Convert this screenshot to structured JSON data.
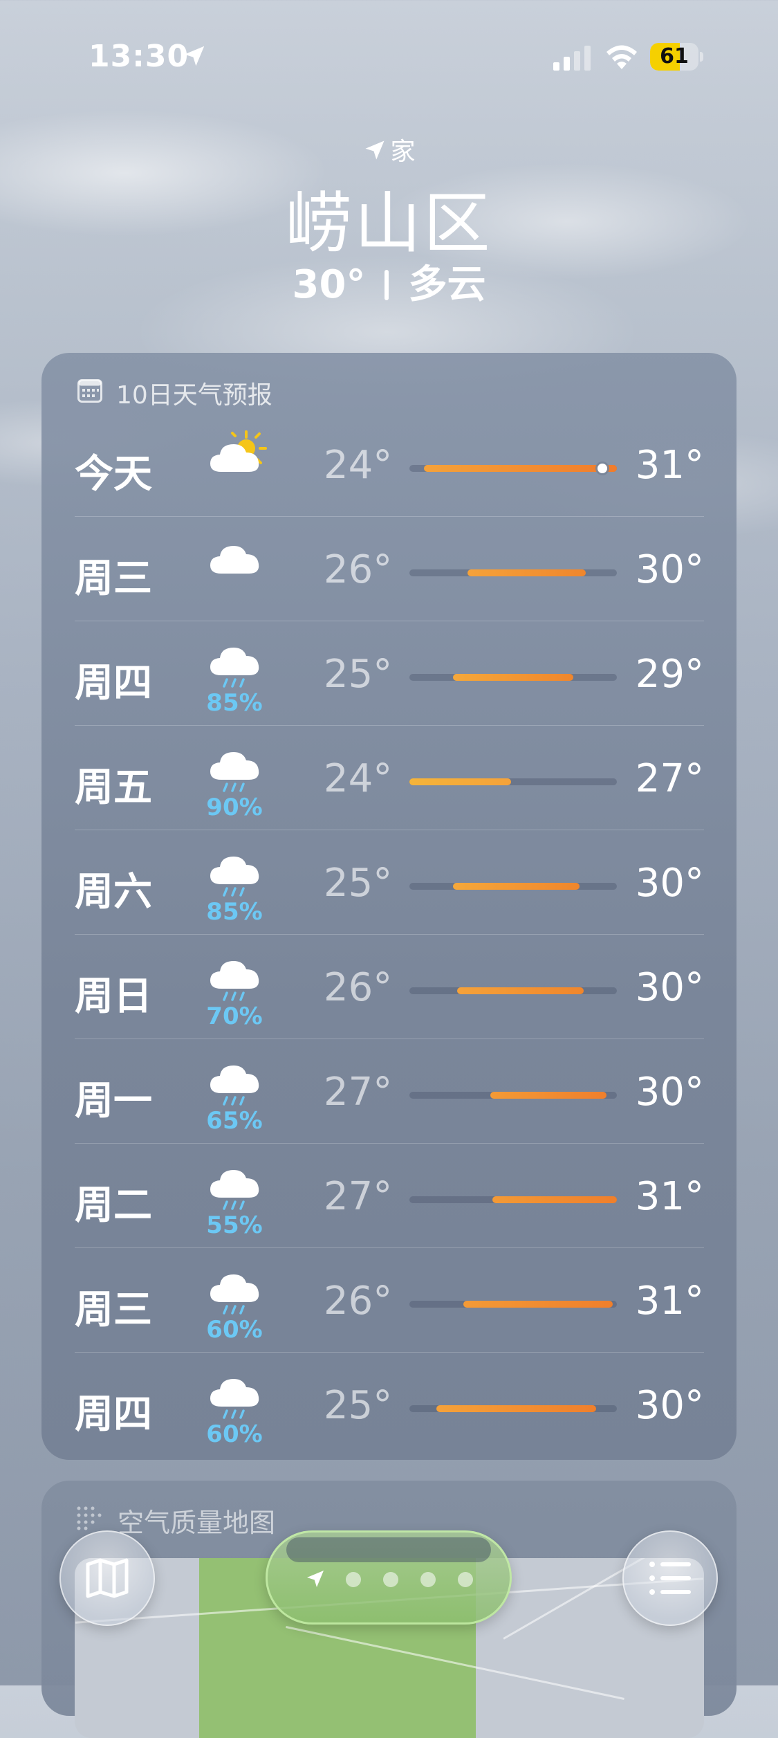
{
  "status_bar": {
    "time": "13:30",
    "battery_level": "61",
    "battery_color": "#f5d000"
  },
  "header": {
    "location_label": "家",
    "city": "崂山区",
    "current_temp": "30°",
    "condition": "多云"
  },
  "forecast": {
    "title": "10日天气预报",
    "icon": "calendar-icon",
    "rows": [
      {
        "day": "今天",
        "icon": "partly-sunny-icon",
        "precip": "",
        "low": "24°",
        "high": "31°",
        "range_start": 0.07,
        "range_end": 1.0,
        "current_marker": 0.93,
        "color_a": "#f5a23a",
        "color_b": "#f07c2c"
      },
      {
        "day": "周三",
        "icon": "cloud-icon",
        "precip": "",
        "low": "26°",
        "high": "30°",
        "range_start": 0.28,
        "range_end": 0.85,
        "color_a": "#f5a23a",
        "color_b": "#f0862c"
      },
      {
        "day": "周四",
        "icon": "rain-cloud-icon",
        "precip": "85%",
        "low": "25°",
        "high": "29°",
        "range_start": 0.21,
        "range_end": 0.79,
        "color_a": "#f5a83a",
        "color_b": "#f0862c"
      },
      {
        "day": "周五",
        "icon": "rain-cloud-icon",
        "precip": "90%",
        "low": "24°",
        "high": "27°",
        "range_start": 0.0,
        "range_end": 0.49,
        "color_a": "#f5b43a",
        "color_b": "#f5a23a"
      },
      {
        "day": "周六",
        "icon": "rain-cloud-icon",
        "precip": "85%",
        "low": "25°",
        "high": "30°",
        "range_start": 0.21,
        "range_end": 0.82,
        "color_a": "#f5a83a",
        "color_b": "#f0862c"
      },
      {
        "day": "周日",
        "icon": "rain-cloud-icon",
        "precip": "70%",
        "low": "26°",
        "high": "30°",
        "range_start": 0.23,
        "range_end": 0.84,
        "color_a": "#f5a23a",
        "color_b": "#f0862c"
      },
      {
        "day": "周一",
        "icon": "rain-cloud-icon",
        "precip": "65%",
        "low": "27°",
        "high": "30°",
        "range_start": 0.39,
        "range_end": 0.95,
        "color_a": "#f39a36",
        "color_b": "#ef7f2c"
      },
      {
        "day": "周二",
        "icon": "rain-cloud-icon",
        "precip": "55%",
        "low": "27°",
        "high": "31°",
        "range_start": 0.4,
        "range_end": 1.0,
        "color_a": "#f39a36",
        "color_b": "#ef7f2c"
      },
      {
        "day": "周三",
        "icon": "rain-cloud-icon",
        "precip": "60%",
        "low": "26°",
        "high": "31°",
        "range_start": 0.26,
        "range_end": 0.98,
        "color_a": "#f39a36",
        "color_b": "#ef7f2c"
      },
      {
        "day": "周四",
        "icon": "rain-cloud-icon",
        "precip": "60%",
        "low": "25°",
        "high": "30°",
        "range_start": 0.13,
        "range_end": 0.9,
        "color_a": "#f5a23a",
        "color_b": "#ef7f2c"
      }
    ]
  },
  "air_quality": {
    "title": "空气质量地图"
  },
  "toolbar": {
    "map_icon": "map-icon",
    "list_icon": "list-icon",
    "page_count": 5,
    "current_page": 0
  },
  "colors": {
    "precip": "#6cc8f4",
    "temp_bar_track": "#46526a"
  }
}
